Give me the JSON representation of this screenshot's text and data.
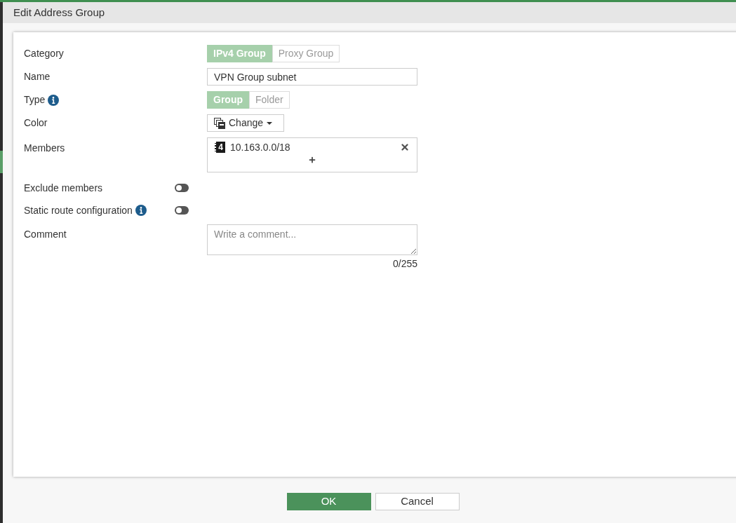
{
  "dialog": {
    "title": "Edit Address Group"
  },
  "fields": [
    {
      "kind": "segmented",
      "label": "Category",
      "options": [
        {
          "label": "IPv4 Group",
          "selected": true
        },
        {
          "label": "Proxy Group",
          "selected": false
        }
      ]
    },
    {
      "kind": "text",
      "label": "Name",
      "value": "VPN Group subnet"
    },
    {
      "kind": "segmented",
      "label": "Type",
      "info": true,
      "options": [
        {
          "label": "Group",
          "selected": true
        },
        {
          "label": "Folder",
          "selected": false
        }
      ]
    },
    {
      "kind": "color",
      "label": "Color",
      "button": "Change"
    },
    {
      "kind": "members",
      "label": "Members",
      "members": [
        {
          "badge": "4",
          "value": "10.163.0.0/18"
        }
      ]
    },
    {
      "kind": "toggle",
      "label": "Exclude members",
      "on": false
    },
    {
      "kind": "toggle",
      "label": "Static route configuration",
      "info": true,
      "on": false
    },
    {
      "kind": "textarea",
      "label": "Comment",
      "placeholder": "Write a comment...",
      "counter": "0/255"
    }
  ],
  "buttons": [
    {
      "kind": "primary",
      "label": "OK"
    },
    {
      "kind": "secondary",
      "label": "Cancel"
    }
  ]
}
